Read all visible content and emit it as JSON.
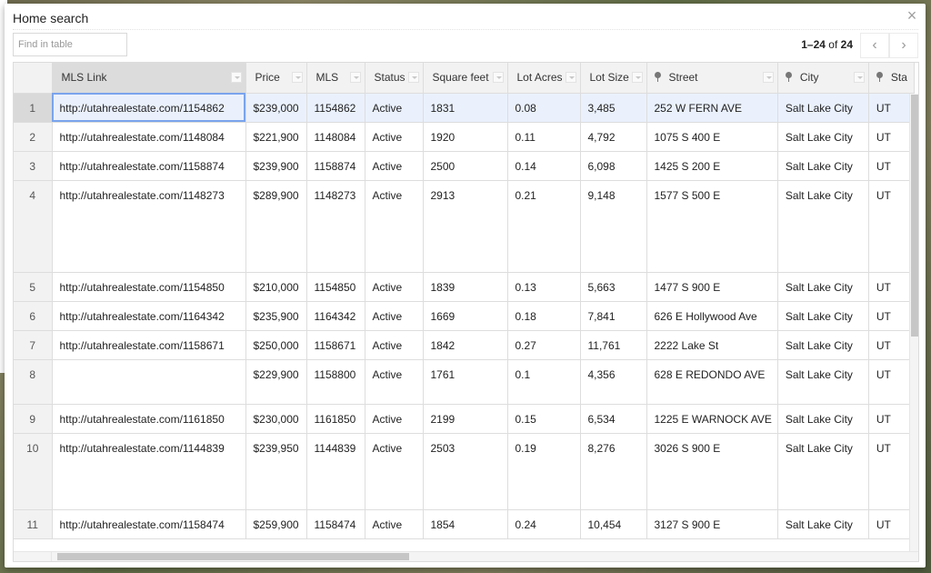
{
  "dialog": {
    "title": "Home search",
    "close_icon": "×",
    "search_placeholder": "Find in table",
    "pager": {
      "range": "1–24",
      "of": "of",
      "total": "24",
      "prev_icon": "‹",
      "next_icon": "›"
    }
  },
  "columns": [
    {
      "label": "MLS Link",
      "pin": false
    },
    {
      "label": "Price",
      "pin": false
    },
    {
      "label": "MLS",
      "pin": false
    },
    {
      "label": "Status",
      "pin": false
    },
    {
      "label": "Square feet",
      "pin": false
    },
    {
      "label": "Lot Acres",
      "pin": false
    },
    {
      "label": "Lot Size",
      "pin": false
    },
    {
      "label": "Street",
      "pin": true
    },
    {
      "label": "City",
      "pin": true
    },
    {
      "label": "Sta",
      "pin": true
    }
  ],
  "rows": [
    {
      "n": "1",
      "link": "http://utahrealestate.com/1154862",
      "price": "$239,000",
      "mls": "1154862",
      "status": "Active",
      "sqft": "1831",
      "acres": "0.08",
      "lot": "3,485",
      "street": "252 W FERN AVE",
      "city": "Salt Lake City",
      "state": "UT"
    },
    {
      "n": "2",
      "link": "http://utahrealestate.com/1148084",
      "price": "$221,900",
      "mls": "1148084",
      "status": "Active",
      "sqft": "1920",
      "acres": "0.11",
      "lot": "4,792",
      "street": "1075 S 400 E",
      "city": "Salt Lake City",
      "state": "UT"
    },
    {
      "n": "3",
      "link": "http://utahrealestate.com/1158874",
      "price": "$239,900",
      "mls": "1158874",
      "status": "Active",
      "sqft": "2500",
      "acres": "0.14",
      "lot": "6,098",
      "street": "1425 S 200 E",
      "city": "Salt Lake City",
      "state": "UT"
    },
    {
      "n": "4",
      "link": "http://utahrealestate.com/1148273",
      "price": "$289,900",
      "mls": "1148273",
      "status": "Active",
      "sqft": "2913",
      "acres": "0.21",
      "lot": "9,148",
      "street": "1577 S 500 E",
      "city": "Salt Lake City",
      "state": "UT"
    },
    {
      "n": "5",
      "link": "http://utahrealestate.com/1154850",
      "price": "$210,000",
      "mls": "1154850",
      "status": "Active",
      "sqft": "1839",
      "acres": "0.13",
      "lot": "5,663",
      "street": "1477 S 900 E",
      "city": "Salt Lake City",
      "state": "UT"
    },
    {
      "n": "6",
      "link": "http://utahrealestate.com/1164342",
      "price": "$235,900",
      "mls": "1164342",
      "status": "Active",
      "sqft": "1669",
      "acres": "0.18",
      "lot": "7,841",
      "street": "626 E Hollywood Ave",
      "city": "Salt Lake City",
      "state": "UT"
    },
    {
      "n": "7",
      "link": "http://utahrealestate.com/1158671",
      "price": "$250,000",
      "mls": "1158671",
      "status": "Active",
      "sqft": "1842",
      "acres": "0.27",
      "lot": "11,761",
      "street": "2222 Lake St",
      "city": "Salt Lake City",
      "state": "UT"
    },
    {
      "n": "8",
      "link": "",
      "price": "$229,900",
      "mls": "1158800",
      "status": "Active",
      "sqft": "1761",
      "acres": "0.1",
      "lot": "4,356",
      "street": "628 E REDONDO AVE",
      "city": "Salt Lake City",
      "state": "UT"
    },
    {
      "n": "9",
      "link": "http://utahrealestate.com/1161850",
      "price": "$230,000",
      "mls": "1161850",
      "status": "Active",
      "sqft": "2199",
      "acres": "0.15",
      "lot": "6,534",
      "street": "1225 E WARNOCK AVE",
      "city": "Salt Lake City",
      "state": "UT"
    },
    {
      "n": "10",
      "link": "http://utahrealestate.com/1144839",
      "price": "$239,950",
      "mls": "1144839",
      "status": "Active",
      "sqft": "2503",
      "acres": "0.19",
      "lot": "8,276",
      "street": "3026 S 900 E",
      "city": "Salt Lake City",
      "state": "UT"
    },
    {
      "n": "11",
      "link": "http://utahrealestate.com/1158474",
      "price": "$259,900",
      "mls": "1158474",
      "status": "Active",
      "sqft": "1854",
      "acres": "0.24",
      "lot": "10,454",
      "street": "3127 S 900 E",
      "city": "Salt Lake City",
      "state": "UT"
    }
  ]
}
